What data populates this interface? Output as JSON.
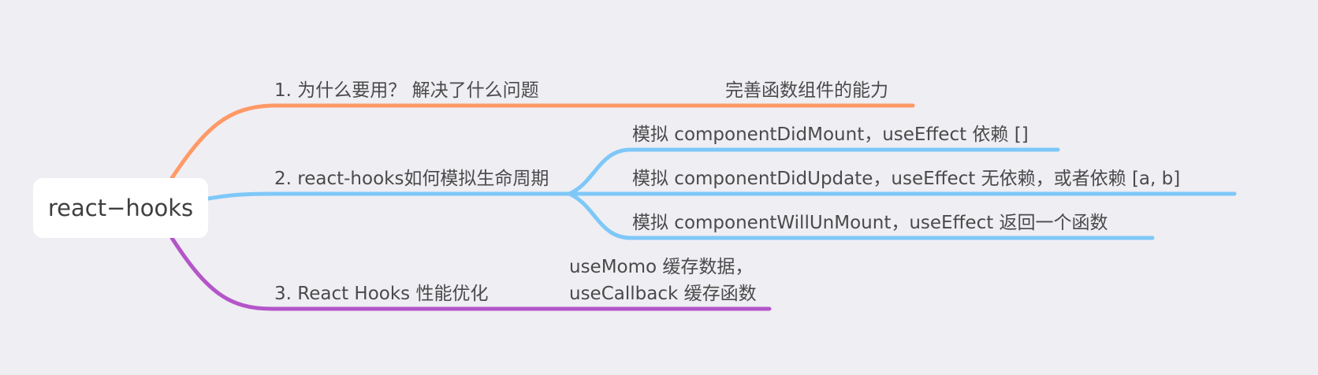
{
  "root": {
    "label": "react−hooks"
  },
  "branches": [
    {
      "label": "1. 为什么要用？  解决了什么问题",
      "color": "#ff9966",
      "children": [
        {
          "label": "完善函数组件的能力"
        }
      ]
    },
    {
      "label": "2. react-hooks如何模拟生命周期",
      "color": "#7ec8f8",
      "children": [
        {
          "label": "模拟 componentDidMount，useEffect 依赖 []"
        },
        {
          "label": "模拟 componentDidUpdate，useEffect 无依赖，或者依赖 [a, b]"
        },
        {
          "label": "模拟 componentWillUnMount，useEffect 返回一个函数"
        }
      ]
    },
    {
      "label": "3. React Hooks 性能优化",
      "color": "#b455c8",
      "children": [
        {
          "label_line1": "useMomo 缓存数据，",
          "label_line2": "useCallback 缓存函数"
        }
      ]
    }
  ]
}
